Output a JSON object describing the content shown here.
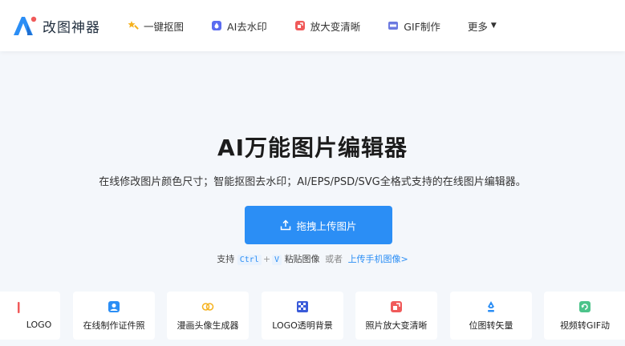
{
  "header": {
    "brand": "改图神器",
    "nav": [
      {
        "label": "一键抠图",
        "icon": "magic-wand-icon"
      },
      {
        "label": "AI去水印",
        "icon": "watermark-icon"
      },
      {
        "label": "放大变清晰",
        "icon": "enhance-icon"
      },
      {
        "label": "GIF制作",
        "icon": "gif-icon"
      }
    ],
    "more_label": "更多"
  },
  "hero": {
    "title": "AI万能图片编辑器",
    "subtitle": "在线修改图片颜色尺寸；智能抠图去水印；AI/EPS/PSD/SVG全格式支持的在线图片编辑器。",
    "upload_label": "拖拽上传图片"
  },
  "hint": {
    "prefix": "支持",
    "key1": "Ctrl",
    "plus": "+",
    "key2": "V",
    "paste": "粘贴图像",
    "or": "或者",
    "mobile_link": "上传手机图像>"
  },
  "tools": [
    {
      "label": "LOGO",
      "icon": "logo-icon",
      "color": "#f05a5a"
    },
    {
      "label": "在线制作证件照",
      "icon": "id-photo-icon",
      "color": "#2b8ef5"
    },
    {
      "label": "漫画头像生成器",
      "icon": "cartoon-avatar-icon",
      "color": "#f5b21f"
    },
    {
      "label": "LOGO透明背景",
      "icon": "transparent-bg-icon",
      "color": "#3a5bd9"
    },
    {
      "label": "照片放大变清晰",
      "icon": "enhance-icon",
      "color": "#f05a5a"
    },
    {
      "label": "位图转矢量",
      "icon": "vector-pen-icon",
      "color": "#2b8ef5"
    },
    {
      "label": "视频转GIF动",
      "icon": "video-gif-icon",
      "color": "#4cc38a"
    }
  ],
  "colors": {
    "accent": "#2b8ef5",
    "background": "#f4f7fb"
  }
}
